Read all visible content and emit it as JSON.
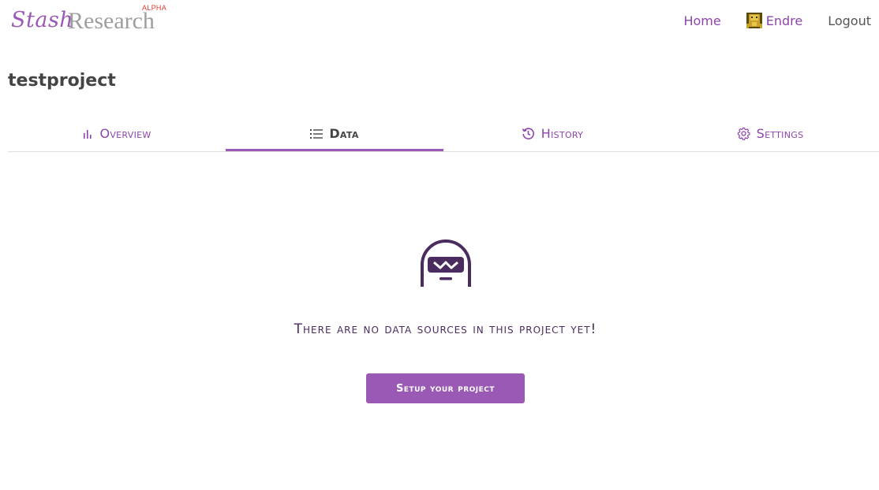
{
  "brand": {
    "part1": "Stash",
    "part2": "Research",
    "badge": "ALPHA"
  },
  "nav": {
    "home": "Home",
    "user": "Endre",
    "logout": "Logout"
  },
  "project": {
    "title": "testproject"
  },
  "tabs": [
    {
      "label": "Overview",
      "icon": "bar-chart-icon",
      "active": false
    },
    {
      "label": "Data",
      "icon": "list-icon",
      "active": true
    },
    {
      "label": "History",
      "icon": "history-icon",
      "active": false
    },
    {
      "label": "Settings",
      "icon": "gear-icon",
      "active": false
    }
  ],
  "empty_state": {
    "icon": "helmet-mascot-icon",
    "message": "There are no data sources in this project yet!",
    "button": "Setup your project"
  },
  "colors": {
    "accent": "#9b59b6",
    "dark_purple": "#4a2c5e",
    "alpha_red": "#e53935"
  }
}
